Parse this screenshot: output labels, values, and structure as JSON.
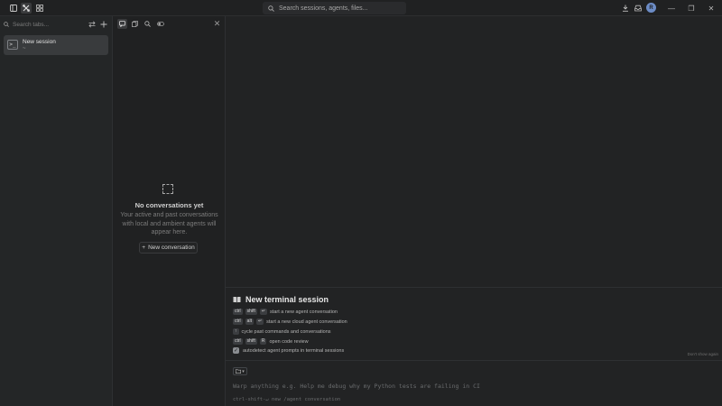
{
  "titlebar": {
    "search_placeholder": "Search sessions, agents, files...",
    "icons": [
      "sidebar-toggle-icon",
      "command-icon",
      "grid-icon",
      "download-icon",
      "inbox-icon",
      "avatar",
      "minimize-icon",
      "restore-icon",
      "close-icon"
    ],
    "avatar_initial": "R",
    "minimize": "—",
    "restore": "❐",
    "close": "✕"
  },
  "tabs_panel": {
    "search_placeholder": "Search tabs...",
    "sessions": [
      {
        "name": "New session",
        "sub": "~",
        "icon": ">_"
      }
    ]
  },
  "conversations": {
    "empty_title": "No conversations yet",
    "empty_description": "Your active and past conversations with local and ambient agents will appear here.",
    "new_button": "New conversation"
  },
  "terminal_session": {
    "title": "New terminal session",
    "hints": [
      {
        "keys": [
          "ctrl",
          "shift",
          "↵"
        ],
        "text": "start a new agent conversation"
      },
      {
        "keys": [
          "ctrl",
          "alt",
          "↵"
        ],
        "text": "start a new cloud agent conversation"
      },
      {
        "keys": [
          "↑"
        ],
        "text": "cycle past commands and conversations"
      },
      {
        "keys": [
          "ctrl",
          "shift",
          "R"
        ],
        "text": "open code review"
      }
    ],
    "autodetect": "autodetect agent prompts in terminal sessions",
    "dont_show": "Don't show again"
  },
  "input": {
    "placeholder": "Warp anything e.g. Help me debug why my Python tests are failing in CI",
    "hint": "ctrl-shift-↵ new /agent conversation"
  },
  "colors": {
    "background": "#1f2021",
    "panel": "#242627",
    "selected": "#393b3d",
    "avatar": "#6c8cc6"
  }
}
